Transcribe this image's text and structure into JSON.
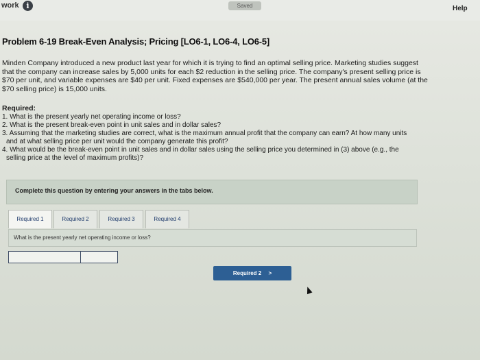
{
  "header": {
    "work_label": "work",
    "info_icon": "i",
    "saved_label": "Saved",
    "help_label": "Help"
  },
  "problem": {
    "title": "Problem 6-19 Break-Even Analysis; Pricing [LO6-1, LO6-4, LO6-5]",
    "intro_lines": [
      "Minden Company introduced a new product last year for which it is trying to find an optimal selling price. Marketing studies suggest",
      "that the company can increase sales by 5,000 units for each $2 reduction in the selling price. The company's present selling price is",
      "$70 per unit, and variable expenses are $40 per unit. Fixed expenses are $540,000 per year. The present annual sales volume (at the",
      "$70 selling price) is 15,000 units."
    ],
    "required_heading": "Required:",
    "required_lines": [
      "1. What is the present yearly net operating income or loss?",
      "2. What is the present break-even point in unit sales and in dollar sales?",
      "3. Assuming that the marketing studies are correct, what is the maximum annual profit that the company can earn? At how many units",
      "and at what selling price per unit would the company generate this profit?",
      "4. What would be the break-even point in unit sales and in dollar sales using the selling price you determined in (3) above (e.g., the",
      "selling price at the level of maximum profits)?"
    ]
  },
  "instructions": "Complete this question by entering your answers in the tabs below.",
  "tabs": [
    {
      "label": "Required 1"
    },
    {
      "label": "Required 2"
    },
    {
      "label": "Required 3"
    },
    {
      "label": "Required 4"
    }
  ],
  "active_question": "What is the present yearly net operating income or loss?",
  "answer": {
    "cell_1": "",
    "cell_2": ""
  },
  "next_button": {
    "label": "Required 2",
    "icon": "chevron-right-icon",
    "glyph": ">"
  }
}
